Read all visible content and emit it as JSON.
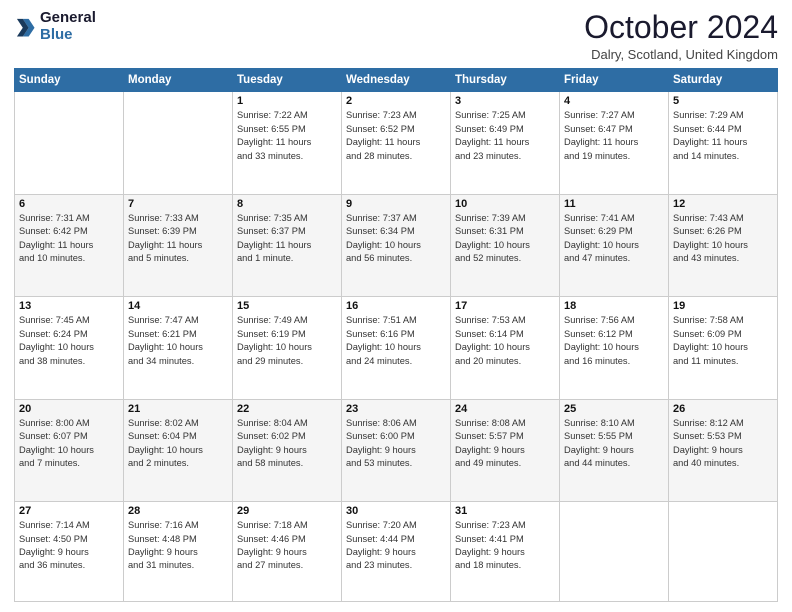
{
  "logo": {
    "line1": "General",
    "line2": "Blue"
  },
  "title": "October 2024",
  "location": "Dalry, Scotland, United Kingdom",
  "days_of_week": [
    "Sunday",
    "Monday",
    "Tuesday",
    "Wednesday",
    "Thursday",
    "Friday",
    "Saturday"
  ],
  "weeks": [
    [
      {
        "num": "",
        "info": ""
      },
      {
        "num": "",
        "info": ""
      },
      {
        "num": "1",
        "info": "Sunrise: 7:22 AM\nSunset: 6:55 PM\nDaylight: 11 hours\nand 33 minutes."
      },
      {
        "num": "2",
        "info": "Sunrise: 7:23 AM\nSunset: 6:52 PM\nDaylight: 11 hours\nand 28 minutes."
      },
      {
        "num": "3",
        "info": "Sunrise: 7:25 AM\nSunset: 6:49 PM\nDaylight: 11 hours\nand 23 minutes."
      },
      {
        "num": "4",
        "info": "Sunrise: 7:27 AM\nSunset: 6:47 PM\nDaylight: 11 hours\nand 19 minutes."
      },
      {
        "num": "5",
        "info": "Sunrise: 7:29 AM\nSunset: 6:44 PM\nDaylight: 11 hours\nand 14 minutes."
      }
    ],
    [
      {
        "num": "6",
        "info": "Sunrise: 7:31 AM\nSunset: 6:42 PM\nDaylight: 11 hours\nand 10 minutes."
      },
      {
        "num": "7",
        "info": "Sunrise: 7:33 AM\nSunset: 6:39 PM\nDaylight: 11 hours\nand 5 minutes."
      },
      {
        "num": "8",
        "info": "Sunrise: 7:35 AM\nSunset: 6:37 PM\nDaylight: 11 hours\nand 1 minute."
      },
      {
        "num": "9",
        "info": "Sunrise: 7:37 AM\nSunset: 6:34 PM\nDaylight: 10 hours\nand 56 minutes."
      },
      {
        "num": "10",
        "info": "Sunrise: 7:39 AM\nSunset: 6:31 PM\nDaylight: 10 hours\nand 52 minutes."
      },
      {
        "num": "11",
        "info": "Sunrise: 7:41 AM\nSunset: 6:29 PM\nDaylight: 10 hours\nand 47 minutes."
      },
      {
        "num": "12",
        "info": "Sunrise: 7:43 AM\nSunset: 6:26 PM\nDaylight: 10 hours\nand 43 minutes."
      }
    ],
    [
      {
        "num": "13",
        "info": "Sunrise: 7:45 AM\nSunset: 6:24 PM\nDaylight: 10 hours\nand 38 minutes."
      },
      {
        "num": "14",
        "info": "Sunrise: 7:47 AM\nSunset: 6:21 PM\nDaylight: 10 hours\nand 34 minutes."
      },
      {
        "num": "15",
        "info": "Sunrise: 7:49 AM\nSunset: 6:19 PM\nDaylight: 10 hours\nand 29 minutes."
      },
      {
        "num": "16",
        "info": "Sunrise: 7:51 AM\nSunset: 6:16 PM\nDaylight: 10 hours\nand 24 minutes."
      },
      {
        "num": "17",
        "info": "Sunrise: 7:53 AM\nSunset: 6:14 PM\nDaylight: 10 hours\nand 20 minutes."
      },
      {
        "num": "18",
        "info": "Sunrise: 7:56 AM\nSunset: 6:12 PM\nDaylight: 10 hours\nand 16 minutes."
      },
      {
        "num": "19",
        "info": "Sunrise: 7:58 AM\nSunset: 6:09 PM\nDaylight: 10 hours\nand 11 minutes."
      }
    ],
    [
      {
        "num": "20",
        "info": "Sunrise: 8:00 AM\nSunset: 6:07 PM\nDaylight: 10 hours\nand 7 minutes."
      },
      {
        "num": "21",
        "info": "Sunrise: 8:02 AM\nSunset: 6:04 PM\nDaylight: 10 hours\nand 2 minutes."
      },
      {
        "num": "22",
        "info": "Sunrise: 8:04 AM\nSunset: 6:02 PM\nDaylight: 9 hours\nand 58 minutes."
      },
      {
        "num": "23",
        "info": "Sunrise: 8:06 AM\nSunset: 6:00 PM\nDaylight: 9 hours\nand 53 minutes."
      },
      {
        "num": "24",
        "info": "Sunrise: 8:08 AM\nSunset: 5:57 PM\nDaylight: 9 hours\nand 49 minutes."
      },
      {
        "num": "25",
        "info": "Sunrise: 8:10 AM\nSunset: 5:55 PM\nDaylight: 9 hours\nand 44 minutes."
      },
      {
        "num": "26",
        "info": "Sunrise: 8:12 AM\nSunset: 5:53 PM\nDaylight: 9 hours\nand 40 minutes."
      }
    ],
    [
      {
        "num": "27",
        "info": "Sunrise: 7:14 AM\nSunset: 4:50 PM\nDaylight: 9 hours\nand 36 minutes."
      },
      {
        "num": "28",
        "info": "Sunrise: 7:16 AM\nSunset: 4:48 PM\nDaylight: 9 hours\nand 31 minutes."
      },
      {
        "num": "29",
        "info": "Sunrise: 7:18 AM\nSunset: 4:46 PM\nDaylight: 9 hours\nand 27 minutes."
      },
      {
        "num": "30",
        "info": "Sunrise: 7:20 AM\nSunset: 4:44 PM\nDaylight: 9 hours\nand 23 minutes."
      },
      {
        "num": "31",
        "info": "Sunrise: 7:23 AM\nSunset: 4:41 PM\nDaylight: 9 hours\nand 18 minutes."
      },
      {
        "num": "",
        "info": ""
      },
      {
        "num": "",
        "info": ""
      }
    ]
  ]
}
